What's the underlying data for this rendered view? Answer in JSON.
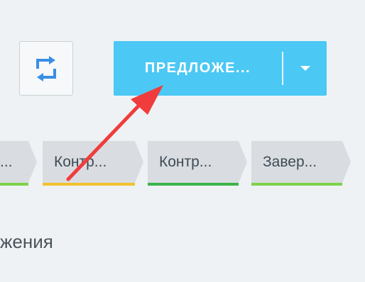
{
  "header": {
    "sync_icon": "refresh-icon",
    "primary_action_label": "ПРЕДЛОЖЕ...",
    "dropdown_icon": "chevron-down-icon",
    "accent_color": "#4bc8f4"
  },
  "stages": [
    {
      "label": "...",
      "bar_color": "#7ed14a"
    },
    {
      "label": "Контр...",
      "bar_color": "#f2c12e"
    },
    {
      "label": "Контр...",
      "bar_color": "#3cb44b"
    },
    {
      "label": "Завер...",
      "bar_color": "#7ed14a"
    }
  ],
  "section": {
    "title": "жения"
  },
  "annotation": {
    "arrow_color": "#f03c3c"
  }
}
